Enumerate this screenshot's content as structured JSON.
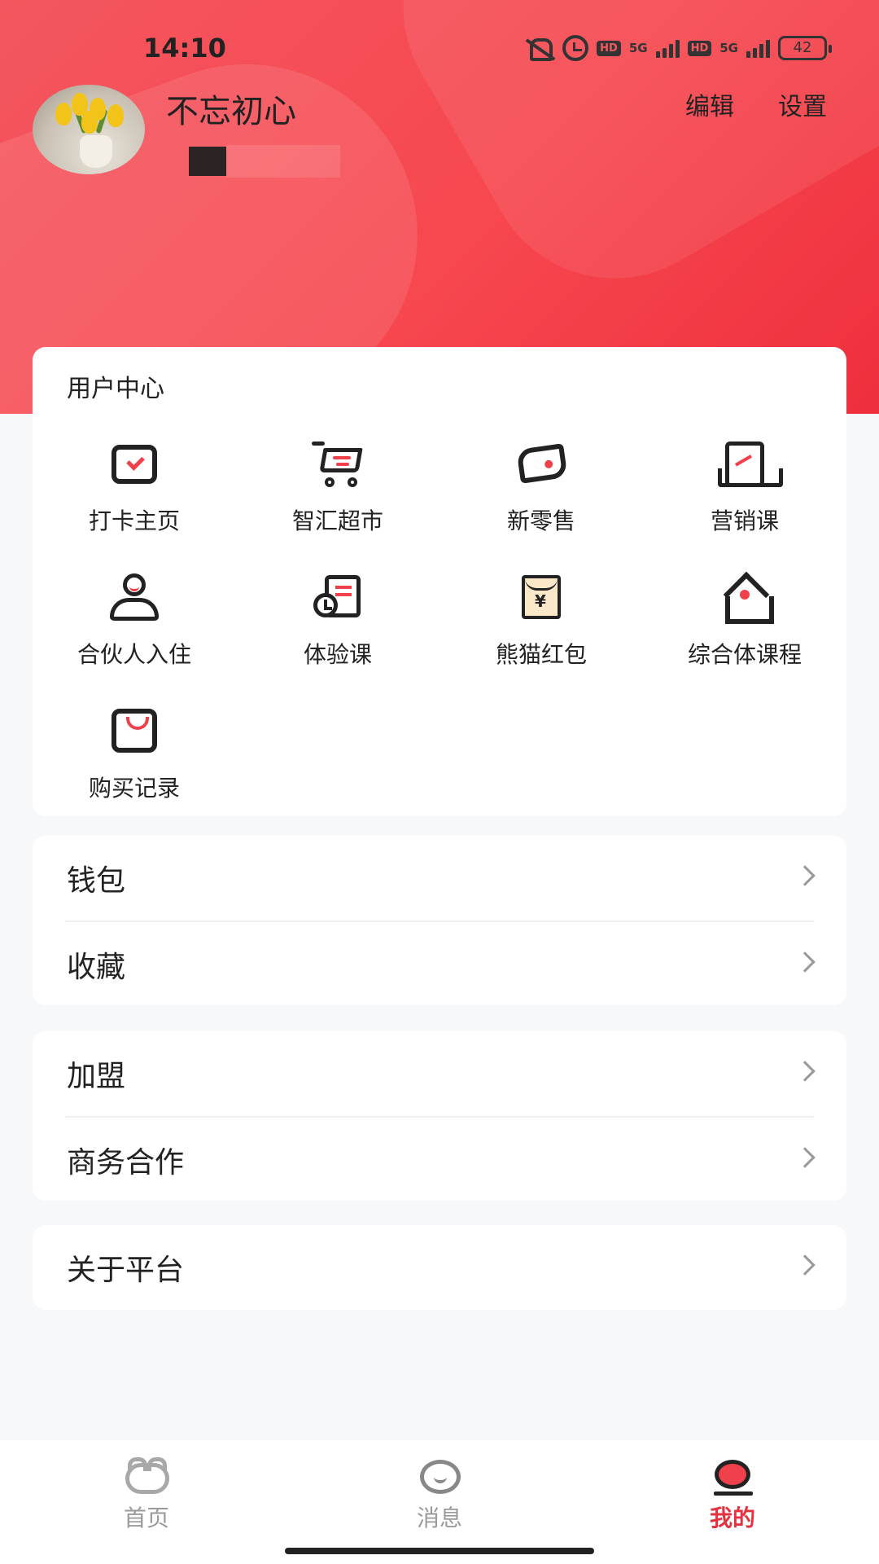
{
  "status_bar": {
    "time": "14:10",
    "signal1": "5G",
    "signal2": "5G",
    "hd": "HD",
    "battery": "42"
  },
  "profile": {
    "username": "不忘初心",
    "edit_label": "编辑",
    "settings_label": "设置"
  },
  "user_center": {
    "title": "用户中心",
    "items": [
      {
        "label": "打卡主页",
        "icon": "checkin-icon"
      },
      {
        "label": "智汇超市",
        "icon": "shopping-cart-icon"
      },
      {
        "label": "新零售",
        "icon": "retail-icon"
      },
      {
        "label": "营销课",
        "icon": "marketing-course-icon"
      },
      {
        "label": "合伙人入住",
        "icon": "partner-icon"
      },
      {
        "label": "体验课",
        "icon": "trial-course-icon"
      },
      {
        "label": "熊猫红包",
        "icon": "red-packet-icon"
      },
      {
        "label": "综合体课程",
        "icon": "complex-course-icon"
      },
      {
        "label": "购买记录",
        "icon": "shopping-bag-icon"
      }
    ],
    "red_packet_symbol": "¥"
  },
  "menu_groups": [
    {
      "rows": [
        {
          "label": "钱包"
        },
        {
          "label": "收藏"
        }
      ]
    },
    {
      "rows": [
        {
          "label": "加盟"
        },
        {
          "label": "商务合作"
        }
      ]
    },
    {
      "rows": [
        {
          "label": "关于平台"
        }
      ]
    }
  ],
  "bottom_nav": {
    "items": [
      {
        "label": "首页"
      },
      {
        "label": "消息"
      },
      {
        "label": "我的"
      }
    ],
    "active_color": "#e5323f",
    "inactive_color": "#9a9a9a"
  },
  "colors": {
    "accent": "#f0404b",
    "header": "#f4565f"
  }
}
